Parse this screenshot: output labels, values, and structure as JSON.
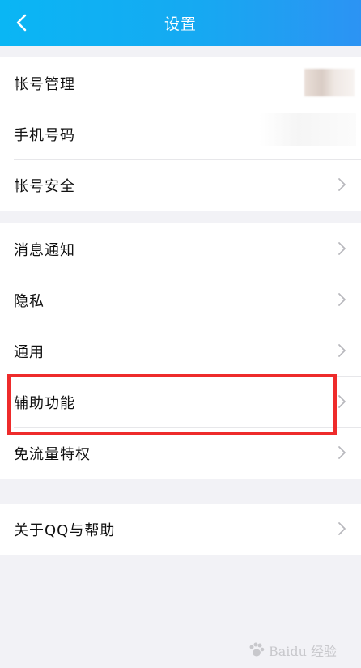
{
  "header": {
    "title": "设置",
    "background": "#16a9f2"
  },
  "groups": [
    {
      "items": [
        {
          "label": "帐号管理"
        },
        {
          "label": "手机号码"
        },
        {
          "label": "帐号安全"
        }
      ]
    },
    {
      "items": [
        {
          "label": "消息通知"
        },
        {
          "label": "隐私"
        },
        {
          "label": "通用"
        },
        {
          "label": "辅助功能"
        },
        {
          "label": "免流量特权"
        }
      ]
    },
    {
      "items": [
        {
          "label": "关于QQ与帮助"
        }
      ]
    }
  ],
  "colors": {
    "highlight": "#ee2b2b",
    "chevron": "#b8b8bd",
    "page_bg": "#f2f2f6"
  },
  "watermark": {
    "text": "Baidu 经验"
  }
}
